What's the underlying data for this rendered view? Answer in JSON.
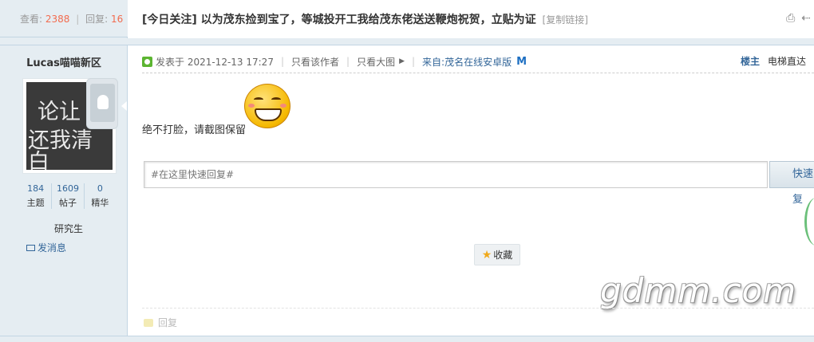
{
  "thread": {
    "views_label": "查看:",
    "views": "2388",
    "sep": "|",
    "replies_label": "回复:",
    "replies": "16",
    "title": "[今日关注] 以为茂东捡到宝了，等城投开工我给茂东佬送送鞭炮祝贺，立贴为证",
    "copy_link": "[复制链接]"
  },
  "author": {
    "name": "Lucas喵喵新区",
    "avatar_text_1": "论让",
    "avatar_text_2": "还我清白",
    "stats": [
      {
        "value": "184",
        "label": "主题"
      },
      {
        "value": "1609",
        "label": "帖子"
      },
      {
        "value": "0",
        "label": "精华"
      }
    ],
    "rank": "研究生",
    "send_message": "发消息"
  },
  "post": {
    "posted_at": "发表于 2021-12-13 17:27",
    "only_author": "只看该作者",
    "big_image": "只看大图",
    "source": "来自:茂名在线安卓版",
    "source_logo": "M",
    "floor": "楼主",
    "elevator": "电梯直达",
    "body": "绝不打脸，请截图保留",
    "emoji": "grinning-face"
  },
  "quick_reply": {
    "placeholder": "#在这里快速回复#",
    "button": "快速回复"
  },
  "actions": {
    "favorite": "收藏",
    "reply": "回复"
  },
  "watermark": "gdmm.com"
}
